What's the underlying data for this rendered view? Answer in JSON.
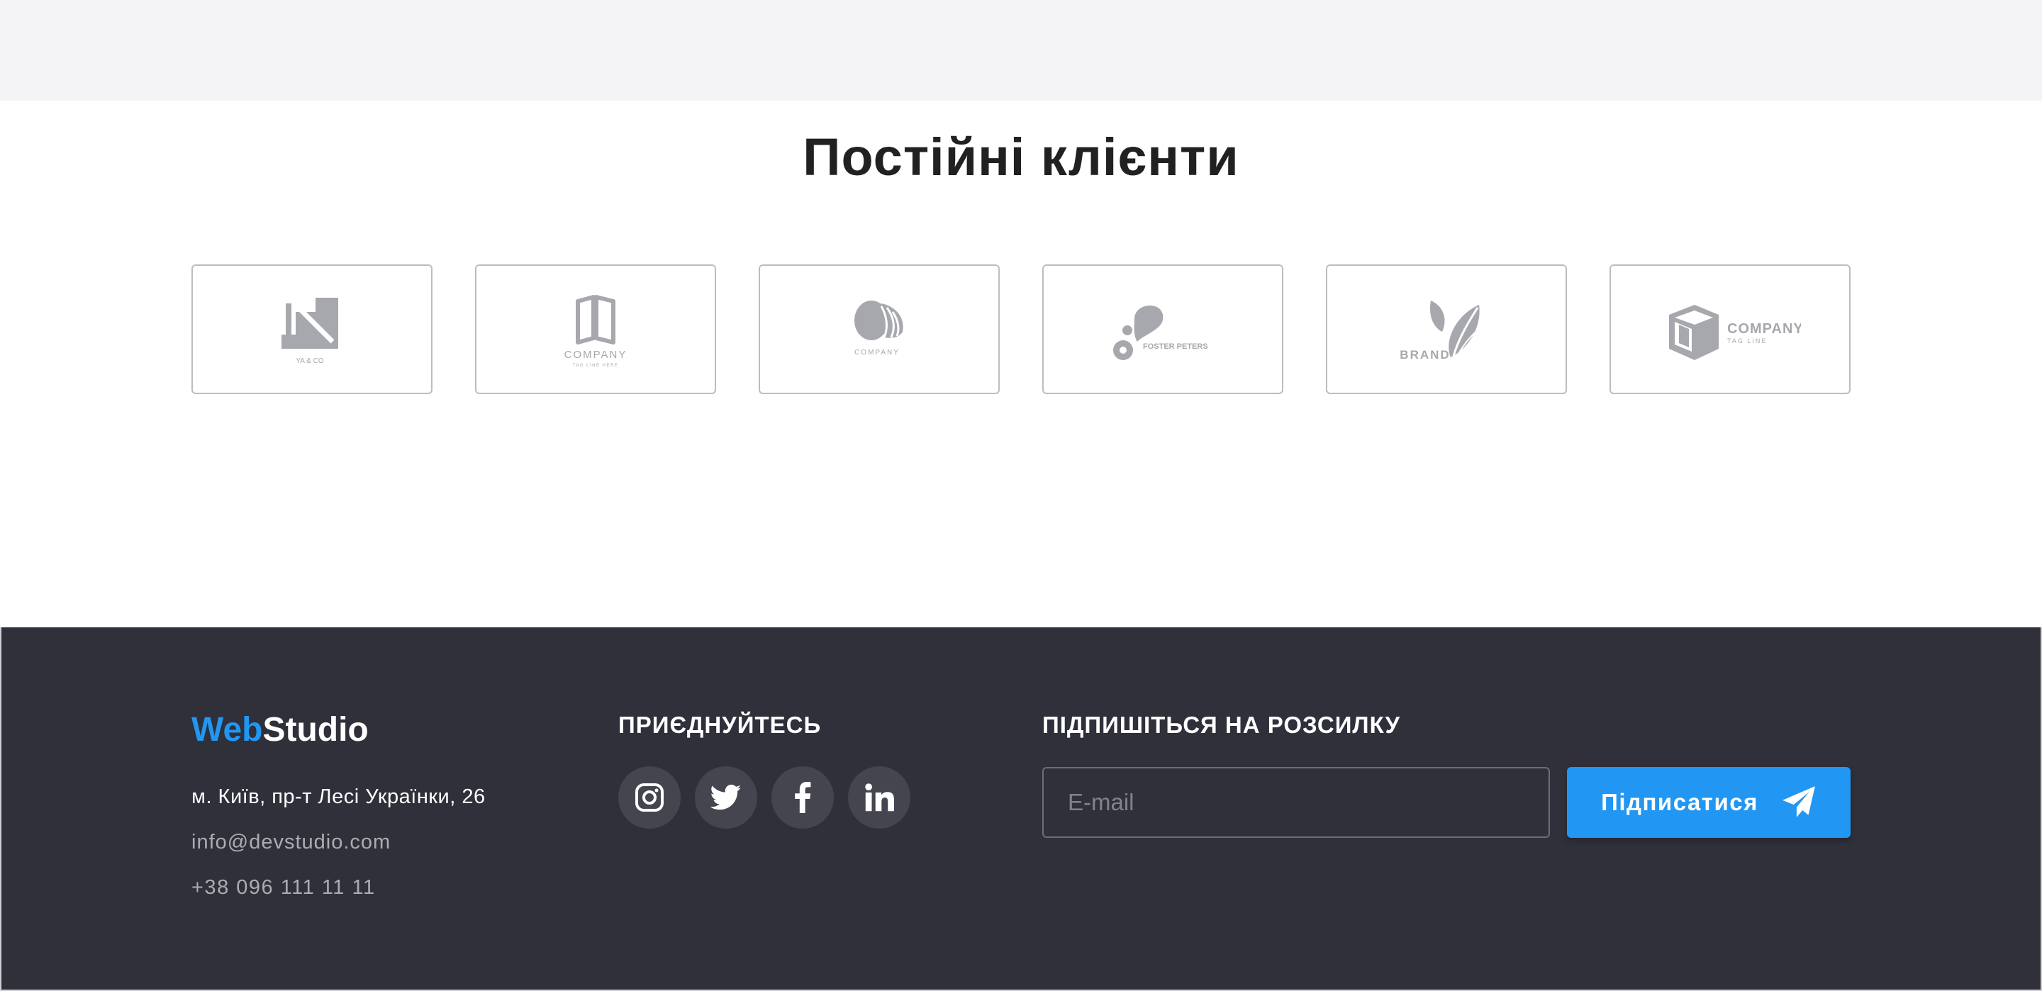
{
  "clients": {
    "title": "Постійні клієнти",
    "logos": [
      {
        "icon": "ya-co-logo-icon",
        "caption": "YA & CO"
      },
      {
        "icon": "book-company-logo-icon",
        "caption": "COMPANY",
        "sub": "TAG LINE HERE"
      },
      {
        "icon": "shell-company-logo-icon",
        "caption": "COMPANY"
      },
      {
        "icon": "foster-peters-logo-icon",
        "caption": "FOSTER PETERS"
      },
      {
        "icon": "brand-leaves-logo-icon",
        "caption": "BRAND"
      },
      {
        "icon": "cube-company-logo-icon",
        "caption": "COMPANY",
        "sub": "TAG LINE"
      }
    ]
  },
  "footer": {
    "brand_part1": "Web",
    "brand_part2": "Studio",
    "address": "м. Київ, пр-т Лесі Українки, 26",
    "email": "info@devstudio.com",
    "phone": "+38 096 111 11 11",
    "join_title": "ПРИЄДНУЙТЕСЬ",
    "social": [
      "instagram-icon",
      "twitter-icon",
      "facebook-icon",
      "linkedin-icon"
    ],
    "subscribe_title": "ПІДПИШІТЬСЯ НА РОЗСИЛКУ",
    "email_placeholder": "E-mail",
    "subscribe_button": "Підписатися"
  },
  "colors": {
    "accent": "#2196f3",
    "footer_bg": "#2f303a",
    "top_band": "#f4f4f7",
    "logo_gray": "#a7a8ad"
  }
}
